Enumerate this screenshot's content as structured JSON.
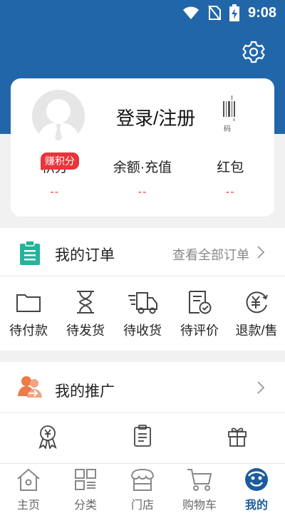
{
  "status_bar": {
    "time": "9:08"
  },
  "profile": {
    "login_label": "登录/注册",
    "barcode_label": "码",
    "stats": [
      {
        "label": "积分",
        "value": "--",
        "badge": "赚积分"
      },
      {
        "label": "余额·充值",
        "value": "--"
      },
      {
        "label": "红包",
        "value": "--"
      }
    ]
  },
  "orders": {
    "title": "我的订单",
    "view_all": "查看全部订单",
    "items": [
      {
        "label": "待付款",
        "icon": "folder-icon"
      },
      {
        "label": "待发货",
        "icon": "hourglass-icon"
      },
      {
        "label": "待收货",
        "icon": "delivery-truck-icon"
      },
      {
        "label": "待评价",
        "icon": "review-document-icon"
      },
      {
        "label": "退款/售",
        "icon": "refund-yen-icon"
      }
    ]
  },
  "promotion": {
    "title": "我的推广",
    "items": [
      {
        "label": "",
        "icon": "yen-medal-icon"
      },
      {
        "label": "",
        "icon": "clipboard-icon"
      },
      {
        "label": "",
        "icon": "gift-icon"
      }
    ]
  },
  "tabbar": {
    "items": [
      {
        "label": "主页",
        "icon": "home-icon"
      },
      {
        "label": "分类",
        "icon": "category-grid-icon"
      },
      {
        "label": "门店",
        "icon": "store-icon"
      },
      {
        "label": "购物车",
        "icon": "cart-icon"
      },
      {
        "label": "我的",
        "icon": "profile-face-icon",
        "active": true
      }
    ]
  },
  "colors": {
    "header": "#2266aa",
    "accent_red": "#e8353a",
    "active_tab": "#1c5c9e",
    "order_icon_teal": "#25b39b",
    "promo_icon_orange": "#ee7a4a"
  }
}
